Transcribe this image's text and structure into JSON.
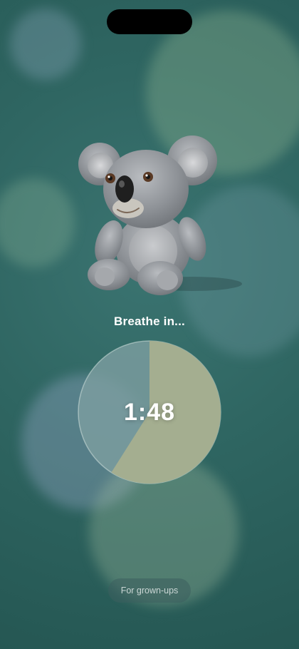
{
  "prompt": "Breathe in...",
  "timer": {
    "display": "1:48",
    "filled_fraction": 0.59,
    "colors": {
      "filled": "#a4ae90",
      "remaining": "#7d9ea0",
      "ring": "#cfe0dd"
    }
  },
  "grownups_button": {
    "label": "For grown-ups"
  },
  "mascot": {
    "icon": "koala-plush-icon"
  }
}
